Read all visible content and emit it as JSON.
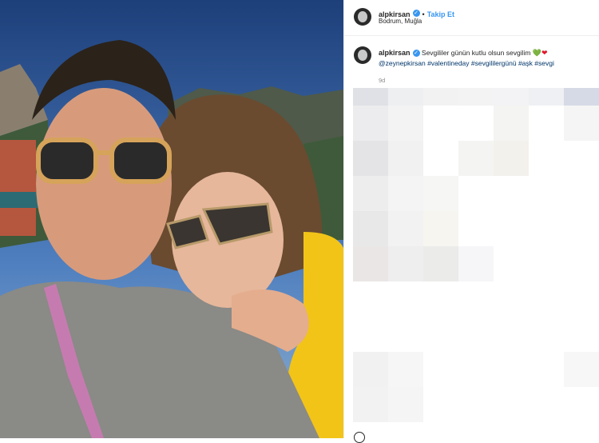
{
  "post": {
    "username": "alpkirsan",
    "verified_glyph": "✓",
    "separator": "•",
    "follow_label": "Takip Et",
    "location": "Bodrum, Muğla"
  },
  "caption": {
    "username": "alpkirsan",
    "text": "Sevgililer günün kutlu olsun sevgilim",
    "hearts": [
      "💚",
      "❤"
    ],
    "heart_colors": [
      "#2eb82e",
      "#e0182d"
    ],
    "mentions": "@zeynepkirsan #valentineday #sevgililergünü #aşk #sevgi",
    "time_ago": "9d"
  },
  "colors": {
    "accent": "#3897f0",
    "tag": "#003569",
    "muted": "#8e8e8e"
  },
  "icons": [
    "verified-icon",
    "avatar",
    "profile-icon"
  ]
}
